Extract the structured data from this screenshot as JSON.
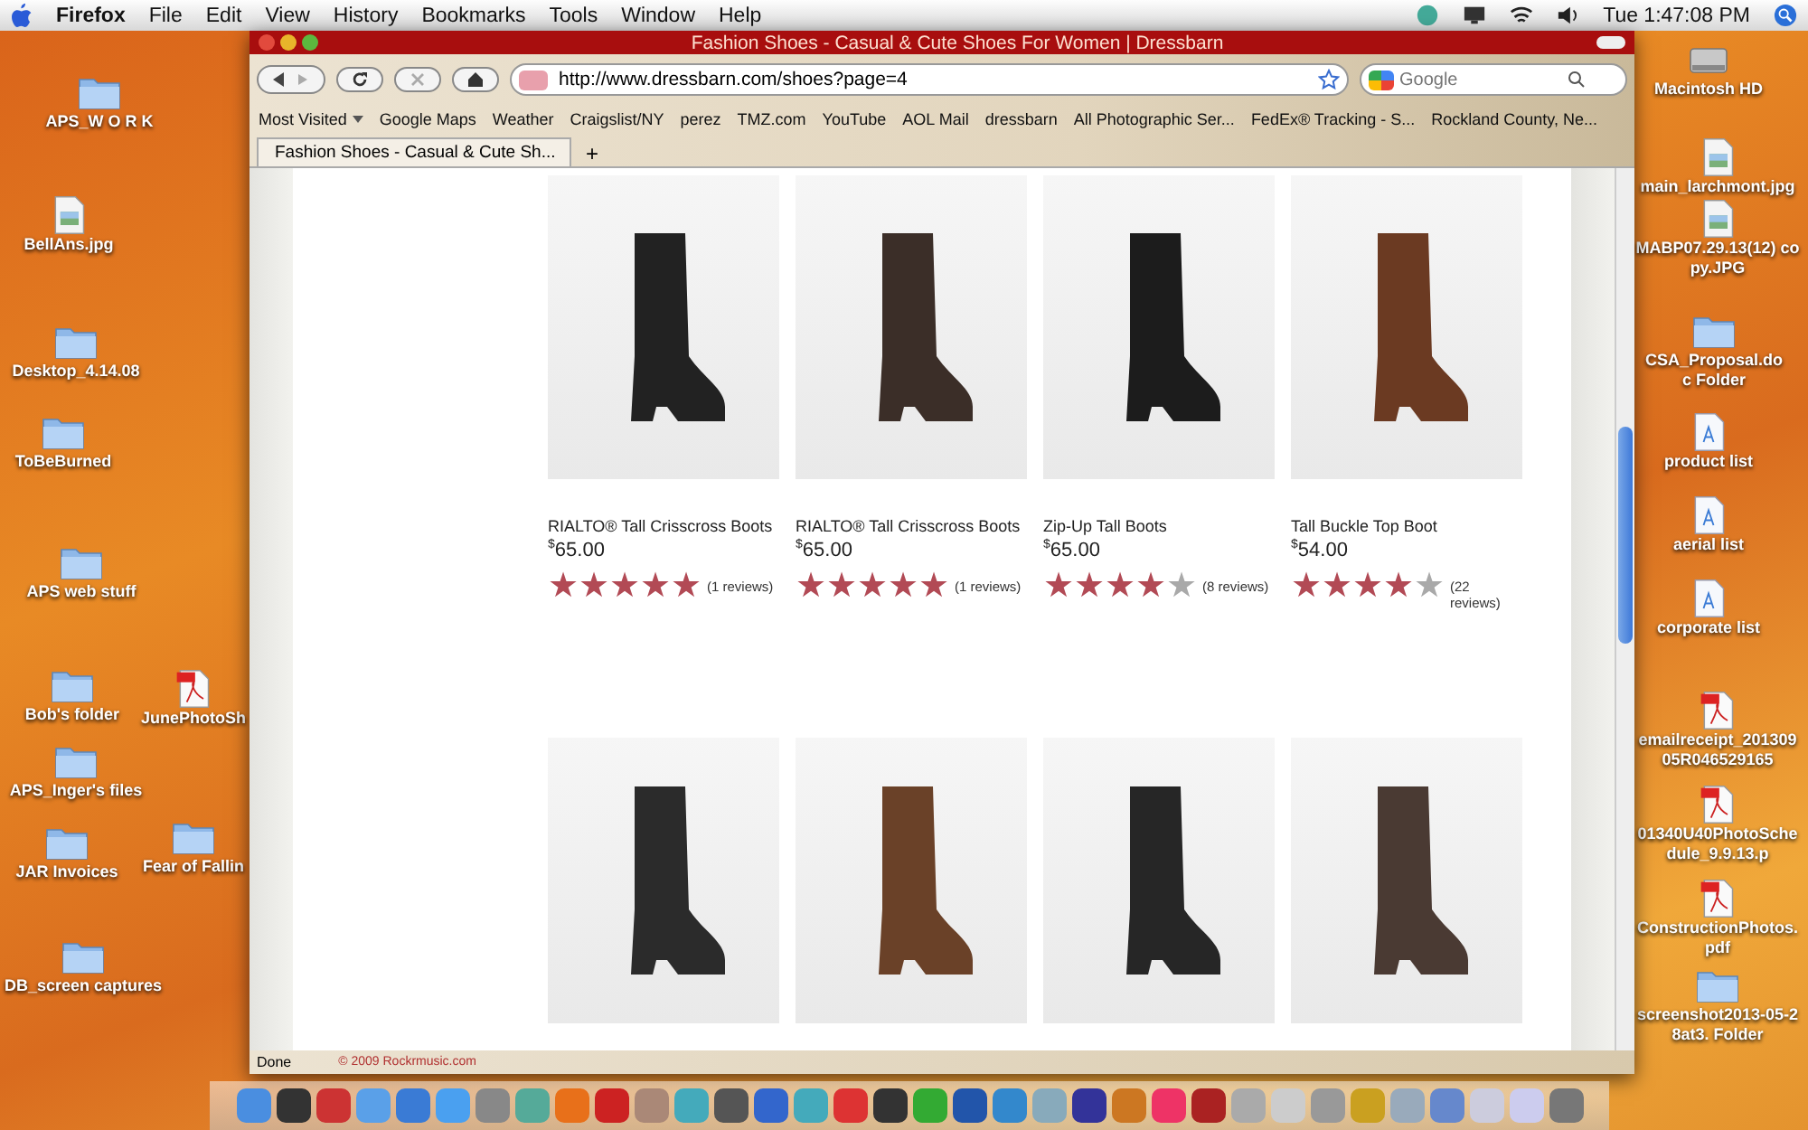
{
  "menubar": {
    "app": "Firefox",
    "menus": [
      "File",
      "Edit",
      "View",
      "History",
      "Bookmarks",
      "Tools",
      "Window",
      "Help"
    ],
    "clock": "Tue 1:47:08 PM"
  },
  "browser": {
    "title": "Fashion Shoes - Casual & Cute Shoes For Women | Dressbarn",
    "url": "http://www.dressbarn.com/shoes?page=4",
    "search_placeholder": "Google",
    "bookmarks": [
      {
        "label": "Most Visited",
        "kind": "menu"
      },
      {
        "label": "Google Maps",
        "kind": "link"
      },
      {
        "label": "Weather",
        "kind": "link"
      },
      {
        "label": "Craigslist/NY",
        "kind": "link"
      },
      {
        "label": "perez",
        "kind": "link"
      },
      {
        "label": "TMZ.com",
        "kind": "link"
      },
      {
        "label": "YouTube",
        "kind": "link"
      },
      {
        "label": "AOL Mail",
        "kind": "link"
      },
      {
        "label": "dressbarn",
        "kind": "link"
      },
      {
        "label": "All Photographic Ser...",
        "kind": "link"
      },
      {
        "label": "FedEx® Tracking - S...",
        "kind": "link"
      },
      {
        "label": "Rockland County, Ne...",
        "kind": "link"
      }
    ],
    "tabs": [
      {
        "label": "Fashion Shoes - Casual & Cute Sh...",
        "selected": true
      }
    ],
    "new_tab": "+",
    "products": [
      {
        "name": "RIALTO® Tall Crisscross Boots",
        "currency": "$",
        "price": "65.00",
        "stars": 5,
        "reviews": "(1 reviews)"
      },
      {
        "name": "RIALTO® Tall Crisscross Boots",
        "currency": "$",
        "price": "65.00",
        "stars": 5,
        "reviews": "(1 reviews)"
      },
      {
        "name": "Zip-Up Tall Boots",
        "currency": "$",
        "price": "65.00",
        "stars": 4,
        "reviews": "(8 reviews)"
      },
      {
        "name": "Tall Buckle Top Boot",
        "currency": "$",
        "price": "54.00",
        "stars": 4,
        "reviews": "(22 reviews)"
      }
    ],
    "status": "Done",
    "footer": "© 2009 Rockrmusic.com"
  },
  "desktop_icons": [
    {
      "label": "APS_W O R K",
      "kind": "folder"
    },
    {
      "label": "BellAns.jpg",
      "kind": "image"
    },
    {
      "label": "Desktop_4.14.08",
      "kind": "folder"
    },
    {
      "label": "ToBeBurned",
      "kind": "folder"
    },
    {
      "label": "APS web stuff",
      "kind": "folder"
    },
    {
      "label": "Bob's folder",
      "kind": "folder"
    },
    {
      "label": "JunePhotoSh",
      "kind": "pdf"
    },
    {
      "label": "APS_Inger's files",
      "kind": "folder"
    },
    {
      "label": "JAR Invoices",
      "kind": "folder"
    },
    {
      "label": "Fear of Fallin",
      "kind": "folder"
    },
    {
      "label": "DB_screen captures",
      "kind": "folder"
    },
    {
      "label": "Macintosh HD",
      "kind": "disk"
    },
    {
      "label": "main_larchmont.jpg",
      "kind": "image"
    },
    {
      "label": "MABP07.29.13(12) copy.JPG",
      "kind": "image"
    },
    {
      "label": "CSA_Proposal.doc Folder",
      "kind": "folder"
    },
    {
      "label": "product list",
      "kind": "doc"
    },
    {
      "label": "aerial list",
      "kind": "doc"
    },
    {
      "label": "corporate list",
      "kind": "doc"
    },
    {
      "label": "emailreceipt_20130905R046529165",
      "kind": "pdf"
    },
    {
      "label": "01340U40PhotoSchedule_9.9.13.p",
      "kind": "pdf"
    },
    {
      "label": "ConstructionPhotos.pdf",
      "kind": "pdf"
    },
    {
      "label": "screenshot2013-05-28at3. Folder",
      "kind": "folder"
    }
  ]
}
